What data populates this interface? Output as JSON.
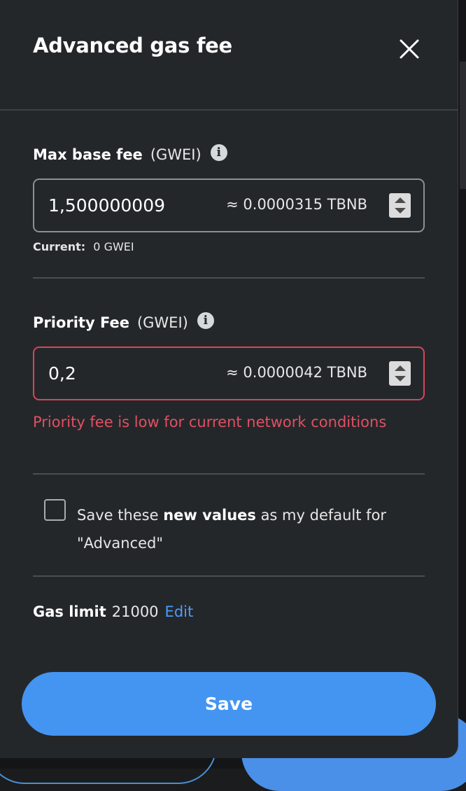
{
  "modal": {
    "title": "Advanced gas fee"
  },
  "max_base_fee": {
    "label": "Max base fee",
    "unit": "(GWEI)",
    "value": "1,500000009",
    "conversion": "≈ 0.0000315 TBNB",
    "current_label": "Current:",
    "current_value": "0 GWEI"
  },
  "priority_fee": {
    "label": "Priority Fee",
    "unit": "(GWEI)",
    "value": "0,2",
    "conversion": "≈ 0.0000042 TBNB",
    "error": "Priority fee is low for current network conditions"
  },
  "save_default": {
    "text_prefix": "Save these ",
    "text_bold": "new values",
    "text_suffix": " as my default for \"Advanced\"",
    "checked": false
  },
  "gas_limit": {
    "label": "Gas limit",
    "value": "21000",
    "edit_label": "Edit"
  },
  "save_button": {
    "label": "Save"
  },
  "colors": {
    "background": "#24272a",
    "accent": "#4495f2",
    "error": "#e05063",
    "link": "#4a9bff"
  }
}
